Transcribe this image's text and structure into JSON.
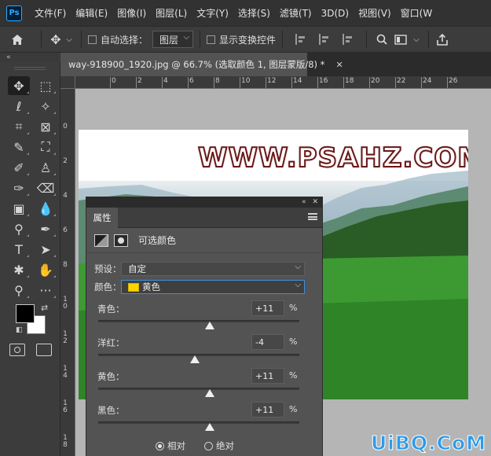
{
  "menubar": {
    "logo": "Ps",
    "items": [
      "文件(F)",
      "编辑(E)",
      "图像(I)",
      "图层(L)",
      "文字(Y)",
      "选择(S)",
      "滤镜(T)",
      "3D(D)",
      "视图(V)",
      "窗口(W"
    ]
  },
  "options": {
    "auto_select_label": "自动选择：",
    "auto_select_value": "图层",
    "show_transform_label": "显示变换控件"
  },
  "toolbar": {
    "collapse_glyph": "«",
    "tools": [
      {
        "icon": "move-tool",
        "glyph": "✥"
      },
      {
        "icon": "marquee-tool",
        "glyph": "⬚"
      },
      {
        "icon": "lasso-tool",
        "glyph": "ℓ"
      },
      {
        "icon": "magic-wand-tool",
        "glyph": "✧"
      },
      {
        "icon": "crop-tool",
        "glyph": "⌗"
      },
      {
        "icon": "frame-tool",
        "glyph": "⊠"
      },
      {
        "icon": "eyedropper-tool",
        "glyph": "✎"
      },
      {
        "icon": "healing-tool",
        "glyph": "⛶"
      },
      {
        "icon": "brush-tool",
        "glyph": "✐"
      },
      {
        "icon": "stamp-tool",
        "glyph": "♙"
      },
      {
        "icon": "history-brush-tool",
        "glyph": "✑"
      },
      {
        "icon": "eraser-tool",
        "glyph": "⌫"
      },
      {
        "icon": "gradient-tool",
        "glyph": "▣"
      },
      {
        "icon": "blur-tool",
        "glyph": "💧"
      },
      {
        "icon": "dodge-tool",
        "glyph": "⚲"
      },
      {
        "icon": "pen-tool",
        "glyph": "✒"
      },
      {
        "icon": "type-tool",
        "glyph": "T"
      },
      {
        "icon": "path-select-tool",
        "glyph": "➤"
      },
      {
        "icon": "shape-tool",
        "glyph": "✱"
      },
      {
        "icon": "hand-tool",
        "glyph": "✋"
      },
      {
        "icon": "zoom-tool",
        "glyph": "⚲"
      },
      {
        "icon": "more-tools",
        "glyph": "···"
      }
    ],
    "foreground_color": "#000000",
    "background_color": "#ffffff"
  },
  "document": {
    "tab_title": "way-918900_1920.jpg @ 66.7% (选取颜色 1, 图层蒙版/8) *",
    "close_glyph": "✕",
    "ruler_top": [
      "0",
      "2",
      "4",
      "6",
      "8",
      "10",
      "12",
      "14",
      "16",
      "18",
      "20",
      "22",
      "24",
      "26"
    ],
    "ruler_left": [
      "0",
      "2",
      "4",
      "6",
      "8",
      "1 0",
      "1 2",
      "1 4",
      "1 6",
      "1 8"
    ],
    "watermark_text": "WWW.PSAHZ.COM"
  },
  "properties": {
    "tab_label": "属性",
    "collapse_glyph": "«",
    "close_glyph": "✕",
    "adjustment_title": "可选颜色",
    "preset_label": "预设：",
    "preset_value": "自定",
    "colors_label": "颜色：",
    "colors_value": "黄色",
    "colors_chip": "#ffd400",
    "sliders": [
      {
        "label": "青色：",
        "value": "+11",
        "unit": "%",
        "level_percent": 11
      },
      {
        "label": "洋红：",
        "value": "-4",
        "unit": "%",
        "level_percent": -4
      },
      {
        "label": "黄色：",
        "value": "+11",
        "unit": "%",
        "level_percent": 11
      },
      {
        "label": "黑色：",
        "value": "+11",
        "unit": "%",
        "level_percent": 11
      }
    ],
    "method_relative": "相对",
    "method_absolute": "绝对",
    "method_selected": "相对"
  },
  "brand": {
    "text": "UiBQ.CoM"
  }
}
